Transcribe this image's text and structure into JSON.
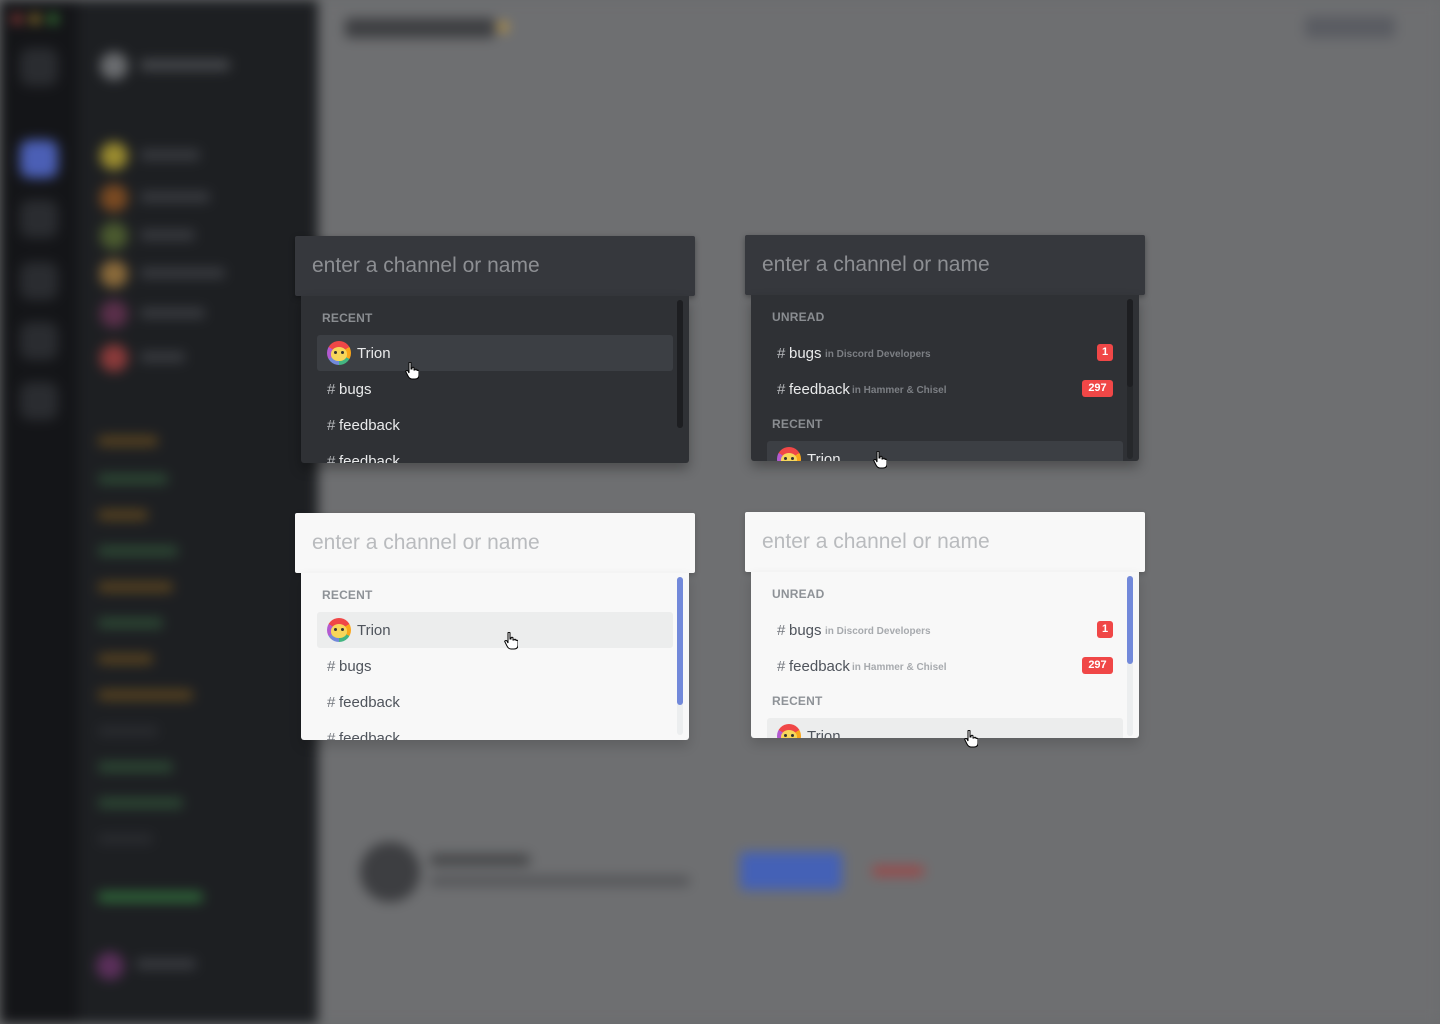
{
  "switcher": {
    "placeholder": "enter a channel or name",
    "recent_header": "RECENT",
    "unread_header": "UNREAD",
    "recent_items": [
      {
        "kind": "user",
        "label": "Trion"
      },
      {
        "kind": "channel",
        "hash": "#",
        "label": "bugs"
      },
      {
        "kind": "channel",
        "hash": "#",
        "label": "feedback"
      },
      {
        "kind": "channel",
        "hash": "#",
        "label": "feedback"
      }
    ],
    "unread_items": [
      {
        "hash": "#",
        "label": "bugs",
        "guild": "in Discord Developers",
        "badge": "1"
      },
      {
        "hash": "#",
        "label": "feedback",
        "guild": "in Hammer & Chisel",
        "badge": "297"
      }
    ],
    "unread_recent_items": [
      {
        "kind": "user",
        "label": "Trion"
      }
    ]
  },
  "colors": {
    "badge": "#f04747",
    "accent_scroll": "#7289da",
    "dark_panel": "#2f3135",
    "light_panel": "#f8f8f8"
  }
}
